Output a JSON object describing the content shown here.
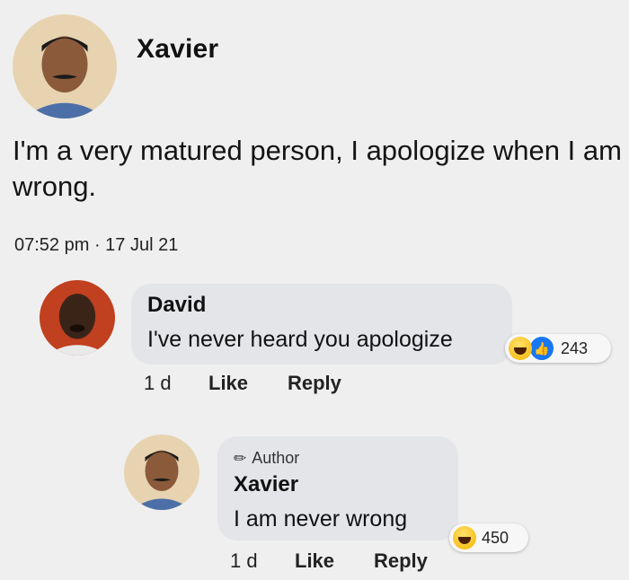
{
  "post": {
    "author": "Xavier",
    "text": "I'm a very matured person, I apologize when I am wrong.",
    "timestamp": "07:52 pm · 17 Jul 21"
  },
  "comments": [
    {
      "name": "David",
      "text": "I've never heard you apologize",
      "age": "1 d",
      "like_label": "Like",
      "reply_label": "Reply",
      "reaction_count": "243",
      "reactions": [
        "haha-emoji-icon",
        "like-icon"
      ]
    },
    {
      "badge": "Author",
      "name": "Xavier",
      "text": "I am never wrong",
      "age": "1 d",
      "like_label": "Like",
      "reply_label": "Reply",
      "reaction_count": "450",
      "reactions": [
        "haha-emoji-icon"
      ]
    }
  ],
  "colors": {
    "background": "#efefef",
    "bubble": "#e3e5e9",
    "like_blue": "#1877f2"
  }
}
